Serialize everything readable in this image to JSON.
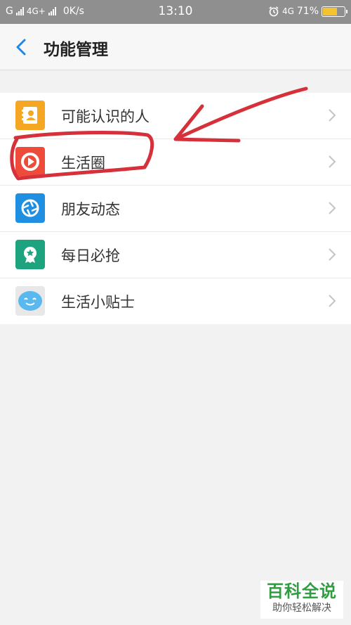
{
  "status_bar": {
    "carrier1": "G",
    "carrier2": "4G+",
    "net_speed": "0K/s",
    "time": "13:10",
    "carrier3": "4G",
    "battery": "71%",
    "battery_level": 0.71,
    "battery_color": "#f4c430"
  },
  "header": {
    "back_icon": "chevron-left-icon",
    "title": "功能管理",
    "accent": "#1e88e5"
  },
  "items": [
    {
      "label": "可能认识的人",
      "icon": "contacts-icon",
      "icon_color": "#f5a623"
    },
    {
      "label": "生活圈",
      "icon": "play-circle-icon",
      "icon_color": "#ee4b3a"
    },
    {
      "label": "朋友动态",
      "icon": "aperture-icon",
      "icon_color": "#1e8fe1"
    },
    {
      "label": "每日必抢",
      "icon": "badge-star-icon",
      "icon_color": "#1da37d"
    },
    {
      "label": "生活小贴士",
      "icon": "smiley-bubble-icon",
      "icon_color": "#59b8ee"
    }
  ],
  "annotation_color": "#d6303b",
  "watermark": {
    "title": "百科全说",
    "subtitle": "助你轻松解决"
  }
}
